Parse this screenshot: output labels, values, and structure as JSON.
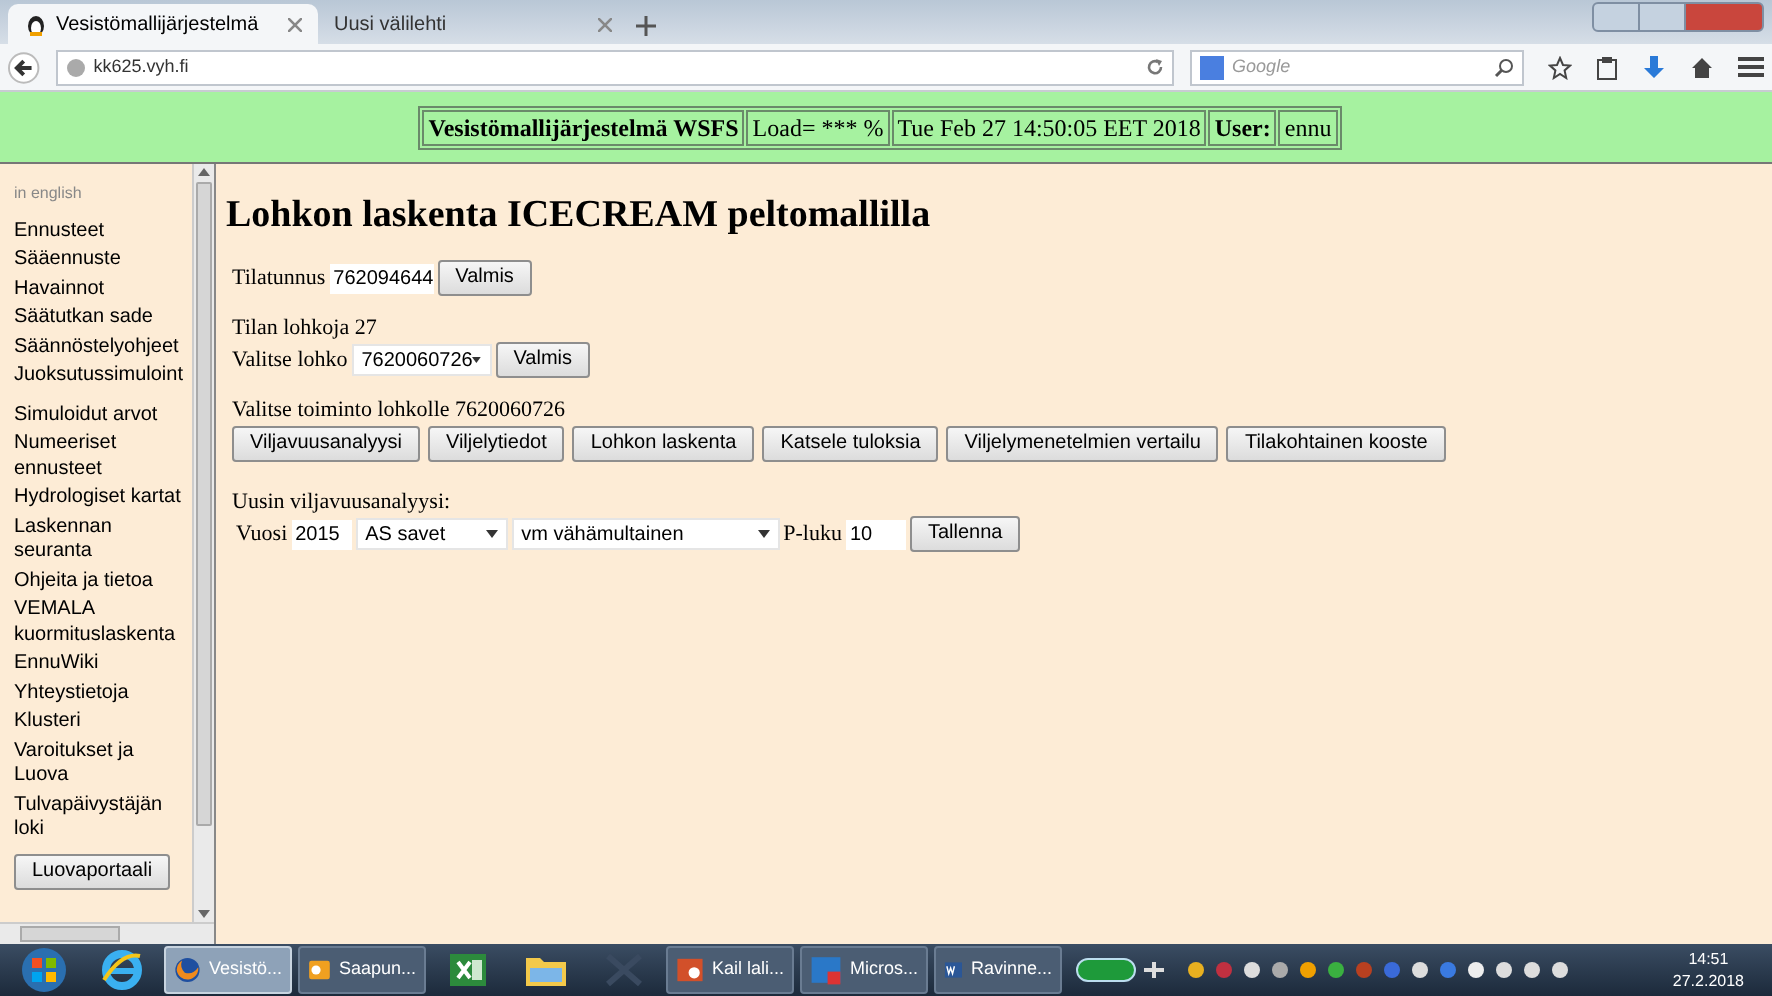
{
  "browser": {
    "tabs": [
      {
        "label": "Vesistömallijärjestelmä",
        "selected": true
      },
      {
        "label": "Uusi välilehti",
        "selected": false
      }
    ],
    "address": "kk625.vyh.fi",
    "search": {
      "placeholder": "Google"
    }
  },
  "header": {
    "cells": [
      {
        "text": "Vesistömallijärjestelmä WSFS",
        "bold": true
      },
      {
        "text": "Load= *** %",
        "bold": false
      },
      {
        "text": "Tue Feb 27 14:50:05 EET 2018",
        "bold": false
      },
      {
        "text": "User:",
        "bold": true
      },
      {
        "text": "ennu",
        "bold": false
      }
    ]
  },
  "sidebar": {
    "items": [
      {
        "kind": "note",
        "label": "in english"
      },
      {
        "kind": "link",
        "label": "Ennusteet"
      },
      {
        "kind": "link",
        "label": "Sääennuste"
      },
      {
        "kind": "link",
        "label": "Havainnot"
      },
      {
        "kind": "link",
        "label": "Säätutkan sade"
      },
      {
        "kind": "link",
        "label": "Säännöstelyohjeet"
      },
      {
        "kind": "link",
        "label": "Juoksutussimuloint"
      },
      {
        "kind": "gap"
      },
      {
        "kind": "link",
        "label": "Simuloidut arvot"
      },
      {
        "kind": "link",
        "label": "Numeeriset ennusteet"
      },
      {
        "kind": "link",
        "label": "Hydrologiset kartat"
      },
      {
        "kind": "link",
        "label": "Laskennan seuranta"
      },
      {
        "kind": "link",
        "label": "Ohjeita ja tietoa"
      },
      {
        "kind": "link",
        "label": "VEMALA kuormituslaskenta"
      },
      {
        "kind": "link",
        "label": "EnnuWiki"
      },
      {
        "kind": "link",
        "label": "Yhteystietoja"
      },
      {
        "kind": "link",
        "label": "Klusteri"
      },
      {
        "kind": "link",
        "label": "Varoitukset ja Luova"
      },
      {
        "kind": "link",
        "label": "Tulvapäivystäjän loki"
      },
      {
        "kind": "button",
        "label": "Luovaportaali"
      }
    ]
  },
  "main": {
    "title": "Lohkon laskenta ICECREAM peltomallilla",
    "farm": {
      "label": "Tilatunnus",
      "value": "762094644",
      "button": "Valmis"
    },
    "count": "Tilan lohkoja 27",
    "parcel": {
      "label": "Valitse lohko",
      "value": "7620060726",
      "button": "Valmis"
    },
    "action_label": "Valitse toiminto lohkolle 7620060726",
    "actions": [
      "Viljavuusanalyysi",
      "Viljelytiedot",
      "Lohkon laskenta",
      "Katsele tuloksia",
      "Viljelymenetelmien vertailu",
      "Tilakohtainen kooste"
    ],
    "analysis": {
      "heading": "Uusin viljavuusanalyysi:",
      "year_label": "Vuosi",
      "year": "2015",
      "soil": "AS savet",
      "humus": "vm vähämultainen",
      "p_label": "P-luku",
      "p_value": "10",
      "button": "Tallenna"
    }
  },
  "taskbar": {
    "items": [
      {
        "kind": "start",
        "selected": false
      },
      {
        "kind": "ie",
        "selected": false
      },
      {
        "kind": "firefox",
        "label": "Vesistö...",
        "selected": true
      },
      {
        "kind": "outlook",
        "label": "Saapun...",
        "selected": false
      },
      {
        "kind": "excel",
        "selected": false
      },
      {
        "kind": "folder",
        "selected": false
      },
      {
        "kind": "tool",
        "selected": false
      },
      {
        "kind": "powerpoint",
        "label": "Kail lali...",
        "selected": false
      },
      {
        "kind": "lync",
        "label": "Micros...",
        "selected": false
      },
      {
        "kind": "word",
        "label": "Ravinne...",
        "selected": false
      }
    ],
    "time": "14:51",
    "date": "27.2.2018"
  }
}
